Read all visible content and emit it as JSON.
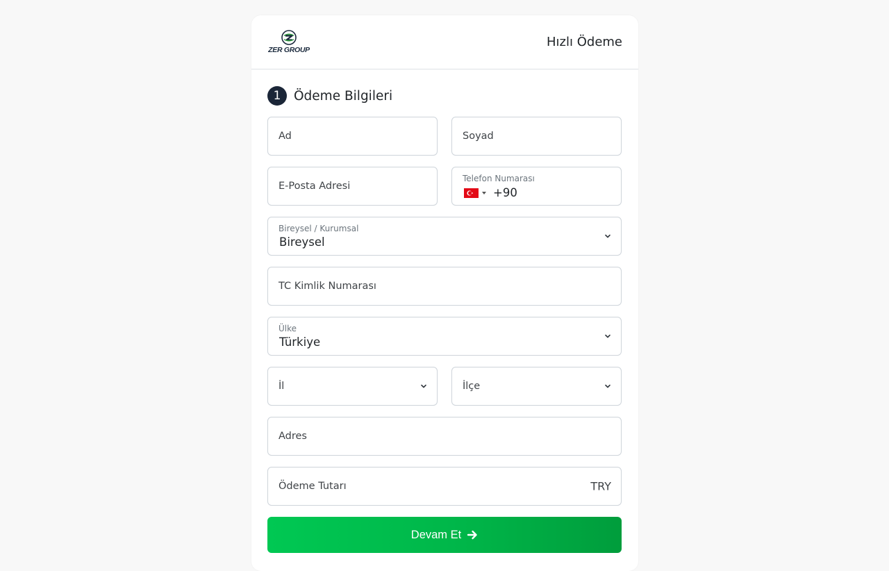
{
  "header": {
    "logo_text": "ZER GROUP",
    "title": "Hızlı Ödeme"
  },
  "section": {
    "step_number": "1",
    "title": "Ödeme Bilgileri"
  },
  "form": {
    "first_name": {
      "placeholder": "Ad"
    },
    "last_name": {
      "placeholder": "Soyad"
    },
    "email": {
      "placeholder": "E-Posta Adresi"
    },
    "phone": {
      "label": "Telefon Numarası",
      "country_code": "+90",
      "flag_icon": "turkey-flag-icon"
    },
    "customer_type": {
      "label": "Bireysel / Kurumsal",
      "value": "Bireysel"
    },
    "tc_id": {
      "placeholder": "TC Kimlik Numarası"
    },
    "country": {
      "label": "Ülke",
      "value": "Türkiye"
    },
    "province": {
      "placeholder": "İl"
    },
    "district": {
      "placeholder": "İlçe"
    },
    "address": {
      "placeholder": "Adres"
    },
    "amount": {
      "placeholder": "Ödeme Tutarı",
      "currency": "TRY"
    }
  },
  "actions": {
    "continue_label": "Devam Et",
    "continue_icon": "arrow-right-icon"
  },
  "colors": {
    "background": "#f8f8f8",
    "badge": "#1b2638",
    "button_start": "#00c853",
    "button_end": "#009d3c",
    "flag_red": "#e30a17"
  }
}
